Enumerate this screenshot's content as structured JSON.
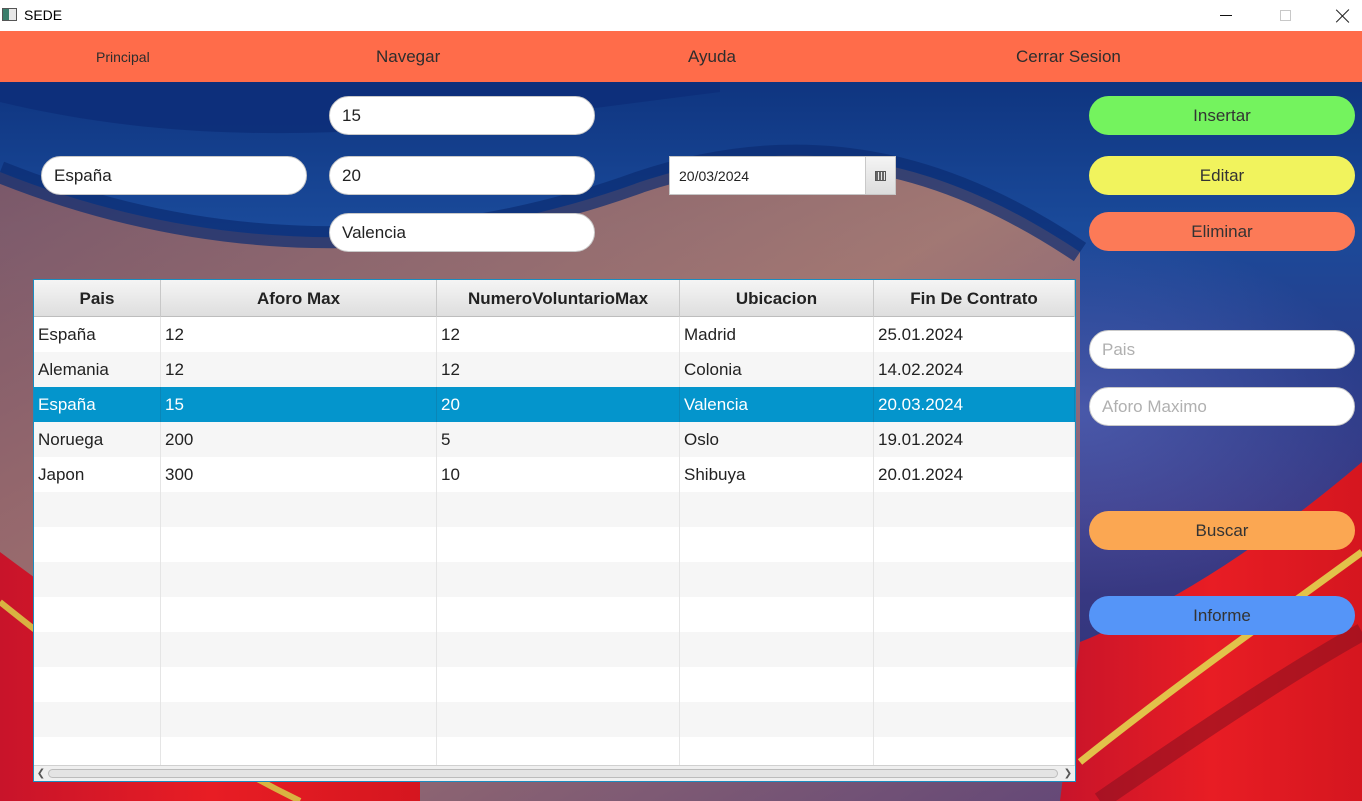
{
  "window": {
    "title": "SEDE"
  },
  "menu": {
    "items": [
      "Principal",
      "Navegar",
      "Ayuda",
      "Cerrar Sesion"
    ]
  },
  "form": {
    "pais_value": "España",
    "aforo_value": "15",
    "voluntarios_value": "20",
    "ubicacion_value": "Valencia",
    "fecha_value": "20/03/2024"
  },
  "actions": {
    "insertar": "Insertar",
    "editar": "Editar",
    "eliminar": "Eliminar",
    "buscar": "Buscar",
    "informe": "Informe"
  },
  "search": {
    "pais_placeholder": "Pais",
    "aforo_placeholder": "Aforo Maximo"
  },
  "table": {
    "columns": [
      "Pais",
      "Aforo Max",
      "NumeroVoluntarioMax",
      "Ubicacion",
      "Fin De Contrato"
    ],
    "rows": [
      [
        "España",
        "12",
        "12",
        "Madrid",
        "25.01.2024"
      ],
      [
        "Alemania",
        "12",
        "12",
        "Colonia",
        "14.02.2024"
      ],
      [
        "España",
        "15",
        "20",
        "Valencia",
        "20.03.2024"
      ],
      [
        "Noruega",
        "200",
        "5",
        "Oslo",
        "19.01.2024"
      ],
      [
        "Japon",
        "300",
        "10",
        "Shibuya",
        "20.01.2024"
      ]
    ],
    "selected_row": 2
  },
  "colors": {
    "menubar": "#ff6c4a",
    "insertar": "#74f35e",
    "editar": "#f1f35d",
    "eliminar": "#fc7a57",
    "buscar": "#fba752",
    "informe": "#5595f8",
    "selection": "#0495cc"
  }
}
